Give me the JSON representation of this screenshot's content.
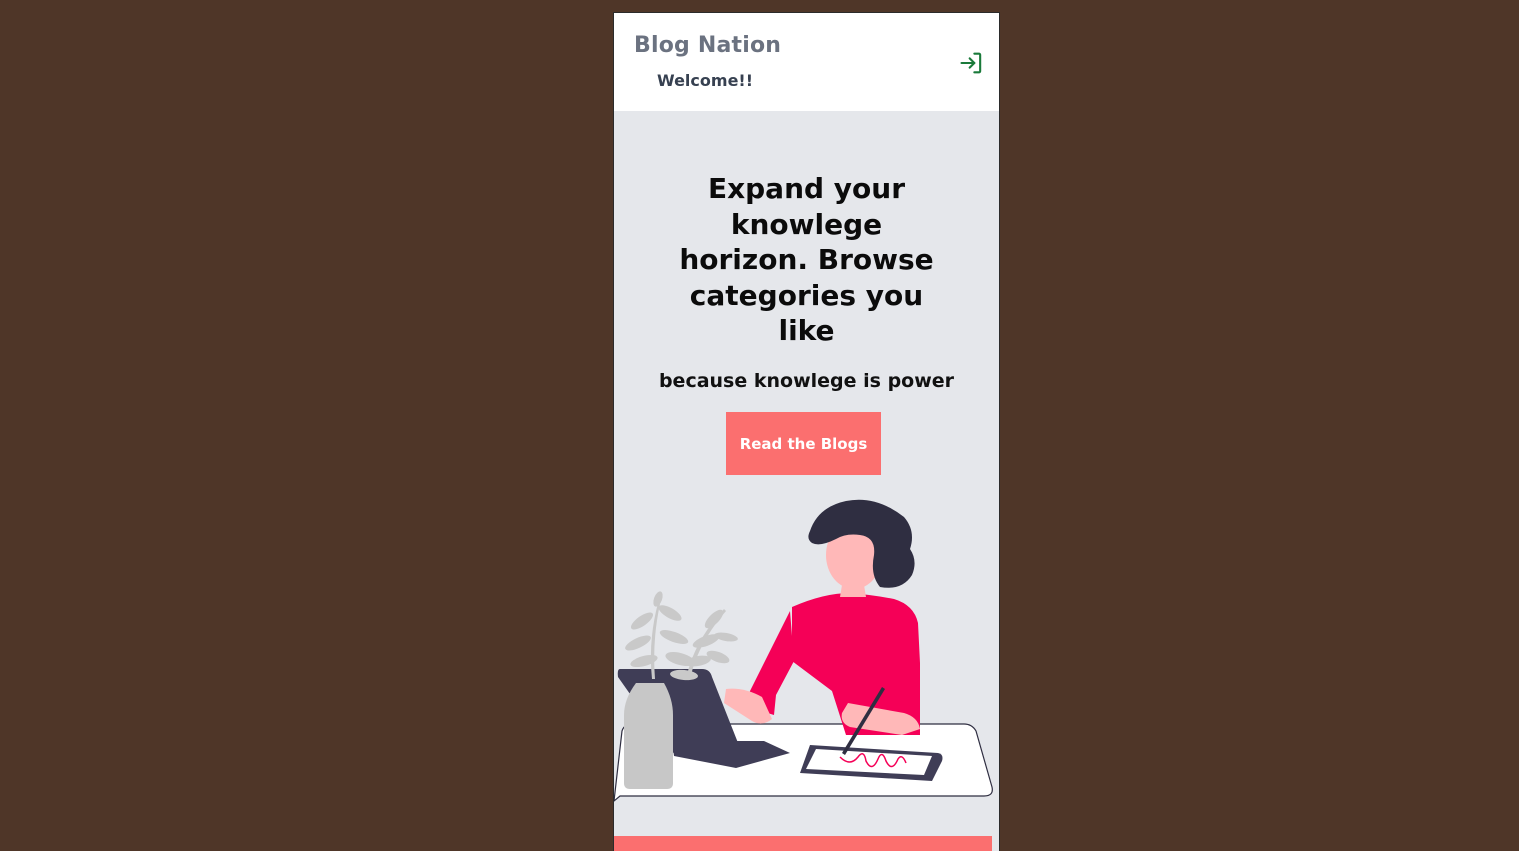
{
  "header": {
    "brand": "Blog Nation",
    "welcome": "Welcome!!",
    "login_icon": "login-icon"
  },
  "hero": {
    "title_lines": [
      "Expand your",
      "knowlege",
      "horizon. Browse",
      "categories you",
      "like"
    ],
    "subtitle": "because knowlege is power",
    "cta_label": "Read the Blogs"
  },
  "colors": {
    "background": "#4f3628",
    "page": "#e5e7eb",
    "header": "#ffffff",
    "accent": "#fb6f6f",
    "shirt": "#f50057",
    "hair": "#2f2e41",
    "login_icon": "#1a7a3a"
  },
  "illustration": {
    "icon": "woman-at-desk-illustration"
  }
}
